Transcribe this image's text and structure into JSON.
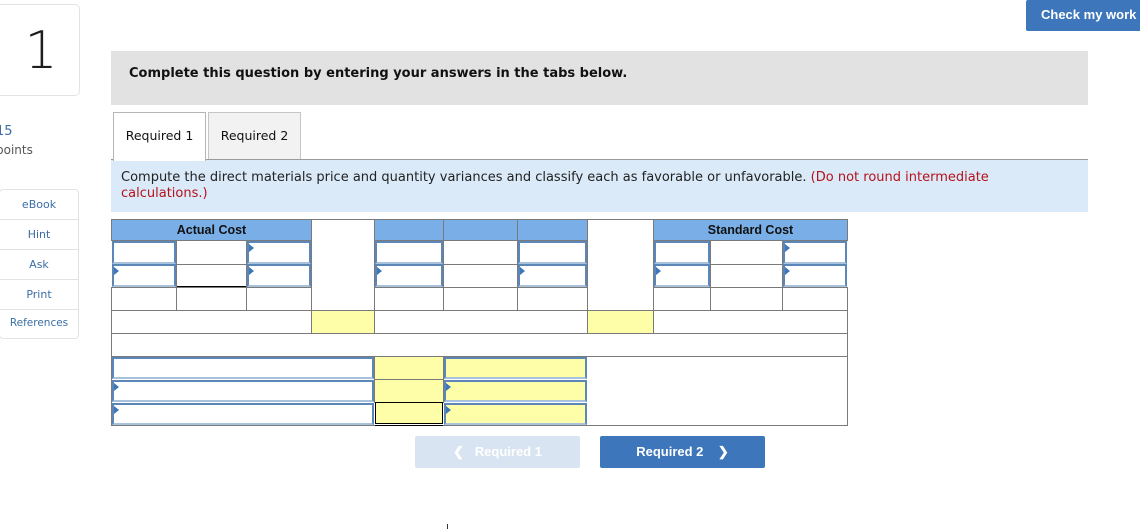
{
  "question": {
    "number": "1",
    "points_value": "15",
    "points_label": "points"
  },
  "tools": [
    {
      "label": "eBook"
    },
    {
      "label": "Hint"
    },
    {
      "label": "Ask"
    },
    {
      "label": "Print"
    },
    {
      "label": "References"
    }
  ],
  "header": {
    "check_button": "Check my work"
  },
  "instructions": "Complete this question by entering your answers in the tabs below.",
  "tabs": [
    {
      "label": "Required 1",
      "active": true
    },
    {
      "label": "Required 2",
      "active": false
    }
  ],
  "prompt": {
    "text": "Compute the direct materials price and quantity variances and classify each as favorable or unfavorable.",
    "note": "(Do not round intermediate calculations.)"
  },
  "table": {
    "headers": {
      "actual_cost": "Actual Cost",
      "standard_cost": "Standard Cost"
    }
  },
  "nav": {
    "prev_label": "Required 1",
    "next_label": "Required 2",
    "prev_icon": "chevron-left-icon",
    "next_icon": "chevron-right-icon"
  },
  "colors": {
    "accent": "#3d76bb",
    "header_blue": "#7aaee6",
    "input_yellow": "#fffea8",
    "prompt_bg": "#dbeaf8",
    "note_red": "#b5121b"
  }
}
